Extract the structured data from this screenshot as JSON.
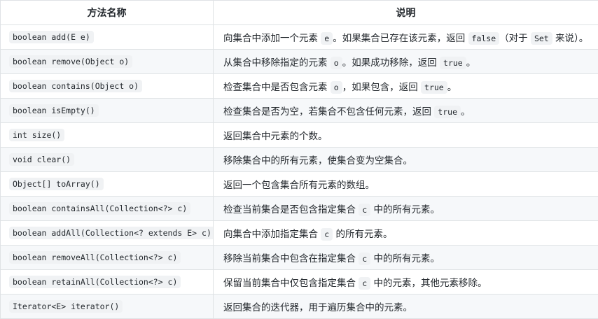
{
  "header": {
    "col_method": "方法名称",
    "col_desc": "说明"
  },
  "rows": [
    {
      "method": "boolean add(E e)",
      "desc": [
        {
          "t": "向集合中添加一个元素 "
        },
        {
          "c": "e"
        },
        {
          "t": "。如果集合已存在该元素，返回 "
        },
        {
          "c": "false"
        },
        {
          "t": "（对于 "
        },
        {
          "c": "Set"
        },
        {
          "t": " 来说）。"
        }
      ]
    },
    {
      "method": "boolean remove(Object o)",
      "desc": [
        {
          "t": "从集合中移除指定的元素 "
        },
        {
          "c": "o"
        },
        {
          "t": "。如果成功移除，返回 "
        },
        {
          "c": "true"
        },
        {
          "t": "。"
        }
      ]
    },
    {
      "method": "boolean contains(Object o)",
      "desc": [
        {
          "t": "检查集合中是否包含元素 "
        },
        {
          "c": "o"
        },
        {
          "t": "，如果包含，返回 "
        },
        {
          "c": "true"
        },
        {
          "t": "。"
        }
      ]
    },
    {
      "method": "boolean isEmpty()",
      "desc": [
        {
          "t": "检查集合是否为空，若集合不包含任何元素，返回 "
        },
        {
          "c": "true"
        },
        {
          "t": "。"
        }
      ]
    },
    {
      "method": "int size()",
      "desc": [
        {
          "t": "返回集合中元素的个数。"
        }
      ]
    },
    {
      "method": "void clear()",
      "desc": [
        {
          "t": "移除集合中的所有元素，使集合变为空集合。"
        }
      ]
    },
    {
      "method": "Object[] toArray()",
      "desc": [
        {
          "t": "返回一个包含集合所有元素的数组。"
        }
      ]
    },
    {
      "method": "boolean containsAll(Collection<?> c)",
      "desc": [
        {
          "t": "检查当前集合是否包含指定集合 "
        },
        {
          "c": "c"
        },
        {
          "t": " 中的所有元素。"
        }
      ]
    },
    {
      "method": "boolean addAll(Collection<? extends E> c)",
      "desc": [
        {
          "t": "向集合中添加指定集合 "
        },
        {
          "c": "c"
        },
        {
          "t": " 的所有元素。"
        }
      ]
    },
    {
      "method": "boolean removeAll(Collection<?> c)",
      "desc": [
        {
          "t": "移除当前集合中包含在指定集合 "
        },
        {
          "c": "c"
        },
        {
          "t": " 中的所有元素。"
        }
      ]
    },
    {
      "method": "boolean retainAll(Collection<?> c)",
      "desc": [
        {
          "t": "保留当前集合中仅包含指定集合 "
        },
        {
          "c": "c"
        },
        {
          "t": " 中的元素，其他元素移除。"
        }
      ]
    },
    {
      "method": "Iterator<E> iterator()",
      "desc": [
        {
          "t": "返回集合的迭代器，用于遍历集合中的元素。"
        }
      ]
    }
  ]
}
